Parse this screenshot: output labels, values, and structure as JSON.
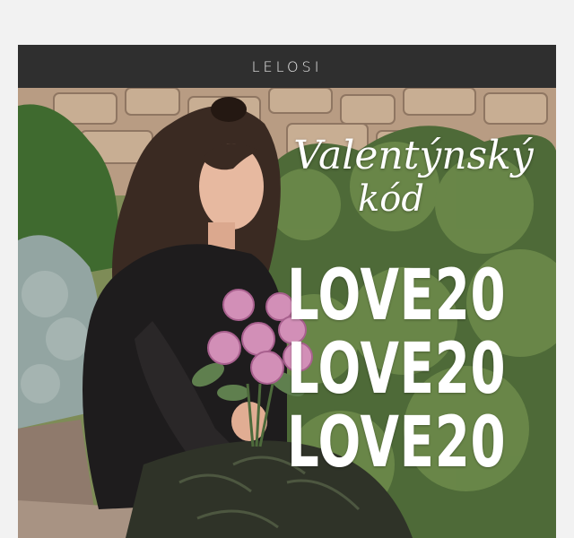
{
  "header": {
    "logo_text": "LELOSI",
    "background_color": "#2f2f2f"
  },
  "hero": {
    "headline_line1": "Valentýnský",
    "headline_line2": "kód",
    "code_lines": [
      "LOVE20",
      "LOVE20",
      "LOVE20"
    ],
    "image_subject": "woman-holding-pink-roses"
  }
}
